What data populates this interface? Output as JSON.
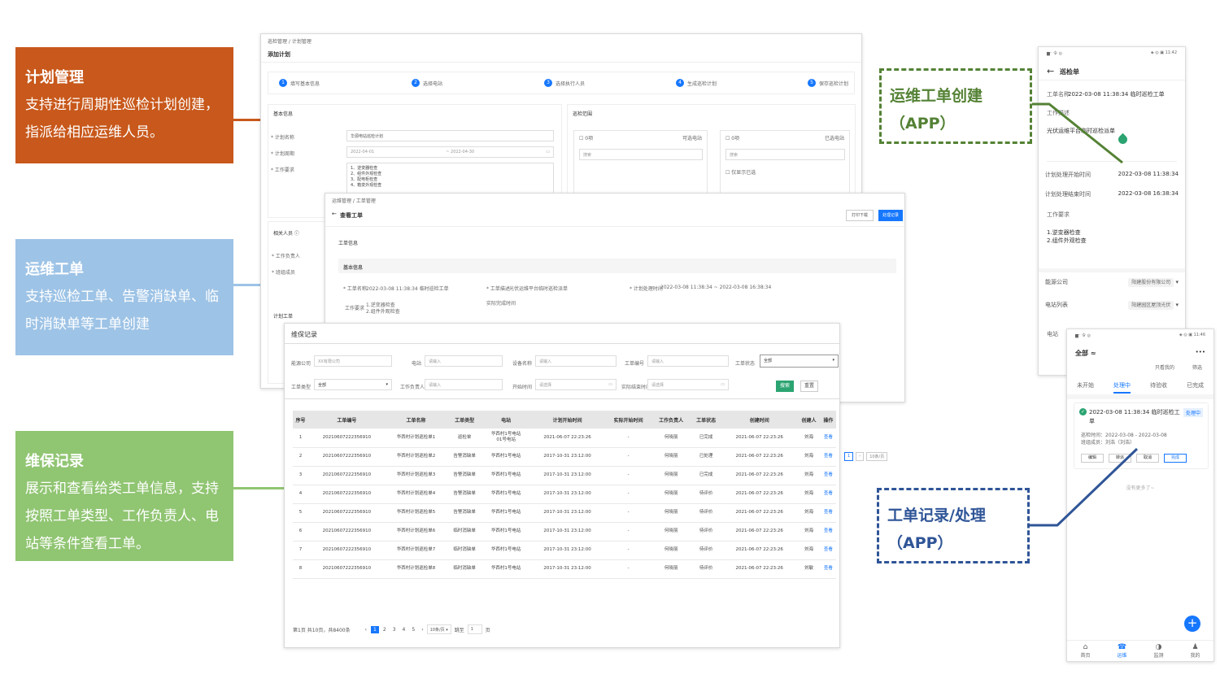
{
  "callouts": {
    "plan": {
      "title": "计划管理",
      "desc": "支持进行周期性巡检计划创建，指派给相应运维人员。",
      "color": "#c8581b"
    },
    "order": {
      "title": "运维工单",
      "desc": "支持巡检工单、告警消缺单、临时消缺单等工单创建",
      "color": "#9dc3e6"
    },
    "record": {
      "title": "维保记录",
      "desc": "展示和查看给类工单信息，支持按照工单类型、工作负责人、电站等条件查看工单。",
      "color": "#90c572"
    },
    "app_create": {
      "title": "运维工单创建",
      "sub": "（APP）",
      "color": "#548235"
    },
    "app_record": {
      "title": "工单记录/处理",
      "sub": "（APP）",
      "color": "#2f5597"
    }
  },
  "plan_screen": {
    "breadcrumb": "巡检管理 / 计划管理",
    "title": "添加计划",
    "steps": [
      "填写基本信息",
      "选择电站",
      "选择执行人员",
      "生成巡检计划",
      "保存巡检计划"
    ],
    "basic_info": "基本信息",
    "patrol_range": "巡检范围",
    "fields": {
      "plan_name_label": "* 计划名称",
      "plan_name_value": "华源电站巡检计划",
      "period_label": "* 计划周期",
      "date_start": "2022-04-01",
      "date_end": "2022-04-30",
      "req_label": "* 工作要求"
    },
    "req_items": [
      "1、逆变器检查",
      "2、组件外观检查",
      "3、配电柜检查",
      "4、箱变外观检查"
    ],
    "left_list": "0项",
    "left_list_right": "可选电站",
    "right_list": "0项",
    "right_list_right": "已选电站",
    "search_ph": "搜索",
    "related": "相关人员 ⓘ",
    "leader": "* 工作负责人",
    "member": "* 班组成员",
    "plan_work": "计划工单",
    "check_opt": "仅显示已选"
  },
  "order_screen": {
    "breadcrumb": "运维管理 / 工单管理",
    "title": "查看工单",
    "btn_print": "打印下载",
    "btn_history": "处理记录",
    "section": "工单信息",
    "basic": "基本信息",
    "name_label": "* 工单名称",
    "name_value": "2022-03-08 11:38:34 临时巡检工单",
    "type_label": "* 工单描述",
    "type_value": "光伏运维平台临时巡检派单",
    "time_label": "* 计划处理时间",
    "time_value": "2022-03-08 11:38:34  ~  2022-03-08 16:38:34",
    "req_label": "工作要求",
    "req_value1": "1.逆变器检查",
    "req_value2": "2.组件外观检查",
    "actual_label": "实际完成时间"
  },
  "record_screen": {
    "title": "维保记录",
    "filters": {
      "company_label": "能源公司",
      "company_ph": "XX有限公司",
      "station_label": "电站",
      "station_ph": "请输入",
      "device_label": "设备名称",
      "device_ph": "请输入",
      "orderno_label": "工单编号",
      "orderno_ph": "请输入",
      "state_label": "工单状态",
      "state_value": "全部",
      "type_label": "工单类型",
      "type_value": "全部",
      "owner_label": "工作负责人",
      "owner_ph": "请输入",
      "start_label": "开始时间",
      "start_ph": "请选择",
      "actual_label": "实际结束时间",
      "actual_ph": "请选择",
      "search_btn": "搜索",
      "reset_btn": "重置"
    },
    "columns": [
      "序号",
      "工单编号",
      "工单名称",
      "工单类型",
      "电站",
      "计划开始时间",
      "实际开始时间",
      "工作负责人",
      "工单状态",
      "创建时间",
      "创建人",
      "操作"
    ],
    "rows": [
      [
        "1",
        "20210607222356910",
        "华西村计划巡检单1",
        "巡检单",
        "华西村1号电站\n01号电站",
        "2021-06-07 22:23:26",
        "-",
        "何晓丽",
        "已完成",
        "2021-06-07 22:23:26",
        "刘海",
        "查看"
      ],
      [
        "2",
        "20210607222356910",
        "华西村计划巡检单2",
        "告警消缺单",
        "华西村1号电站",
        "2017-10-31 23:12:00",
        "-",
        "何晓丽",
        "已处理",
        "2021-06-07 22:23:26",
        "刘海",
        "查看"
      ],
      [
        "3",
        "20210607222356910",
        "华西村计划巡检单3",
        "告警消缺单",
        "华西村1号电站",
        "2017-10-31 23:12:00",
        "-",
        "何晓丽",
        "已完成",
        "2021-06-07 22:23:26",
        "刘海",
        "查看"
      ],
      [
        "4",
        "20210607222356910",
        "华西村计划巡检单4",
        "告警消缺单",
        "华西村1号电站",
        "2017-10-31 23:12:00",
        "-",
        "何晓丽",
        "待评价",
        "2021-06-07 22:23:26",
        "刘海",
        "查看"
      ],
      [
        "5",
        "20210607222356910",
        "华西村计划巡检单5",
        "告警消缺单",
        "华西村1号电站",
        "2017-10-31 23:12:00",
        "-",
        "何晓丽",
        "待评价",
        "2021-06-07 22:23:26",
        "刘海",
        "查看"
      ],
      [
        "6",
        "20210607222356910",
        "华西村计划巡检单6",
        "临时消缺单",
        "华西村1号电站",
        "2017-10-31 23:12:00",
        "-",
        "何晓丽",
        "待评价",
        "2021-06-07 22:23:26",
        "刘海",
        "查看"
      ],
      [
        "7",
        "20210607222356910",
        "华西村计划巡检单7",
        "临时消缺单",
        "华西村1号电站",
        "2017-10-31 23:12:00",
        "-",
        "何晓丽",
        "待评价",
        "2021-06-07 22:23:26",
        "刘海",
        "查看"
      ],
      [
        "8",
        "20210607222356910",
        "华西村计划巡检单8",
        "临时消缺单",
        "华西村1号电站",
        "2017-10-31 23:12:00",
        "-",
        "何晓丽",
        "待评价",
        "2021-06-07 22:23:26",
        "刘敏",
        "查看"
      ]
    ],
    "pager_info": "第1页 共10页，共8400条",
    "pages": [
      "1",
      "2",
      "3",
      "4",
      "5"
    ],
    "page_size": "10条/页",
    "goto_label": "跳至",
    "goto_value": "1",
    "goto_unit": "页",
    "pager_mini": "10条/页"
  },
  "app1": {
    "status": "▆ᐧᐧ 令 ◎",
    "status_right": "◈ ◎ ▣ 11:42",
    "title": "巡检单",
    "name_label": "工单名称",
    "name_value": "2022-03-08 11:38:34 临时巡检工单",
    "desc_label": "工作描述",
    "desc_value": "光伏运维平台临时巡检派单",
    "start_label": "计划处理开始时间",
    "start_value": "2022-03-08 11:38:34",
    "end_label": "计划处理结束时间",
    "end_value": "2022-03-08 16:38:34",
    "req_label": "工作要求",
    "req1": "1.逆变器检查",
    "req2": "2.组件外观检查",
    "company_label": "能源公司",
    "company_value": "阳建股份有限公司",
    "station_label": "电站列表",
    "station_value": "阳建园区屋顶光伏",
    "station2_label": "电站"
  },
  "app2": {
    "status": "▆ᐧᐧ 令 ◎",
    "status_right": "◈ ◎ ▣ 11:46",
    "title": "全部 ≈",
    "more": "•••",
    "filter1": "只看我的",
    "filter2": "筛选",
    "tabs": [
      "未开始",
      "处理中",
      "待验收",
      "已完成"
    ],
    "card_title": "2022-03-08 11:38:34 临时巡检工单",
    "card_badge": "处理中",
    "card_time": "巡检时间：2022-03-08 - 2022-03-08",
    "card_member": "班组成员：刘浩（刘浩）",
    "card_btns": [
      "编辑",
      "转派",
      "取消",
      "完成"
    ],
    "no_more": "没有更多了~",
    "tabbar": [
      "首页",
      "运维",
      "监测",
      "我的"
    ]
  }
}
